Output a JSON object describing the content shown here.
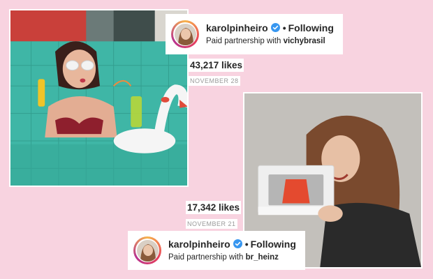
{
  "posts": [
    {
      "username": "karolpinheiro",
      "separator": "•",
      "follow_label": "Following",
      "paid_prefix": "Paid partnership with ",
      "partner": "vichybrasil",
      "likes": "43,217 likes",
      "date": "NOVEMBER 28"
    },
    {
      "username": "karolpinheiro",
      "separator": "•",
      "follow_label": "Following",
      "paid_prefix": "Paid partnership with ",
      "partner": "br_heinz",
      "likes": "17,342 likes",
      "date": "NOVEMBER 21"
    }
  ],
  "colors": {
    "background": "#f8d3e0",
    "verified_badge": "#3897f0",
    "text": "#262626",
    "muted": "#999999"
  },
  "icons": [
    "verified-badge-icon",
    "avatar-ring"
  ]
}
